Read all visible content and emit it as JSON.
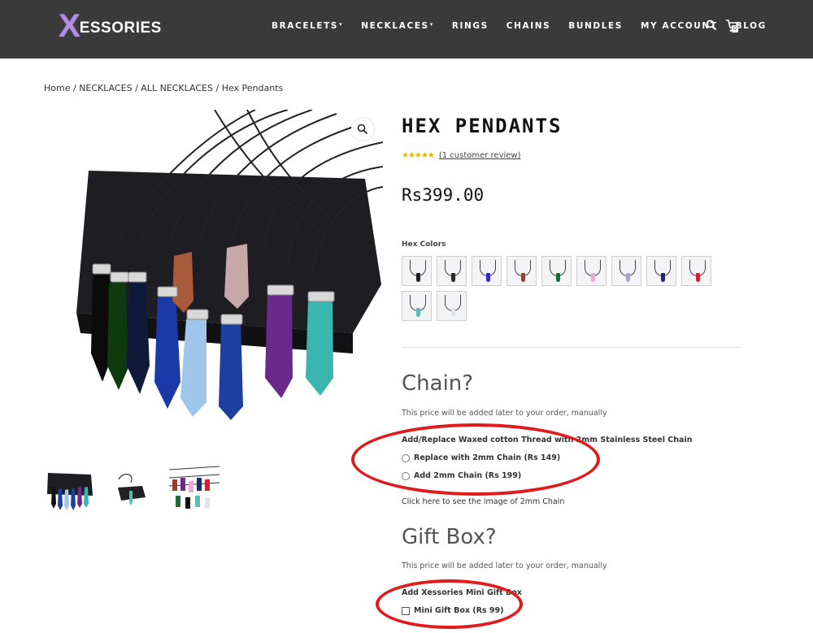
{
  "header": {
    "logo_initial": "X",
    "logo_rest": "ESSORIES",
    "nav": [
      {
        "label": "BRACELETS",
        "dropdown": true
      },
      {
        "label": "NECKLACES",
        "dropdown": true
      },
      {
        "label": "RINGS",
        "dropdown": false
      },
      {
        "label": "CHAINS",
        "dropdown": false
      },
      {
        "label": "BUNDLES",
        "dropdown": false
      },
      {
        "label": "MY ACCOUNT",
        "dropdown": false
      },
      {
        "label": "BLOG",
        "dropdown": false
      }
    ],
    "cart_count": "0",
    "icons": [
      "search-icon",
      "cart-icon"
    ]
  },
  "breadcrumb": {
    "items": [
      "Home",
      "NECKLACES",
      "ALL NECKLACES"
    ],
    "current": "Hex Pendants",
    "separator": " / "
  },
  "product": {
    "title": "HEX PENDANTS",
    "rating_stars": 5,
    "review_text": "(1 customer review)",
    "price": "Rs399.00",
    "attribute_label": "Hex Colors",
    "swatch_colors": [
      "#1c1c1c",
      "#2a2a2a",
      "#2c2ccc",
      "#9b3b2b",
      "#1f6b3a",
      "#e7a9d9",
      "#a6a6c8",
      "#1e2a6e",
      "#d41f2f",
      "#5bbdb0",
      "#dfe6ee"
    ]
  },
  "chain_section": {
    "heading": "Chain?",
    "note": "This price will be added later to your order, manually",
    "option_title": "Add/Replace Waxed cotton Thread with 2mm Stainless Steel Chain",
    "options": [
      "Replace with 2mm Chain (Rs 149)",
      "Add 2mm Chain (Rs 199)"
    ],
    "link_text": "Click here to see the image of 2mm Chain"
  },
  "gift_section": {
    "heading": "Gift Box?",
    "note": "This price will be added later to your order, manually",
    "option_title": "Add Xessories Mini Gift Box",
    "options": [
      "Mini Gift Box (Rs 99)"
    ]
  },
  "annotation_color": "#e01b1b"
}
